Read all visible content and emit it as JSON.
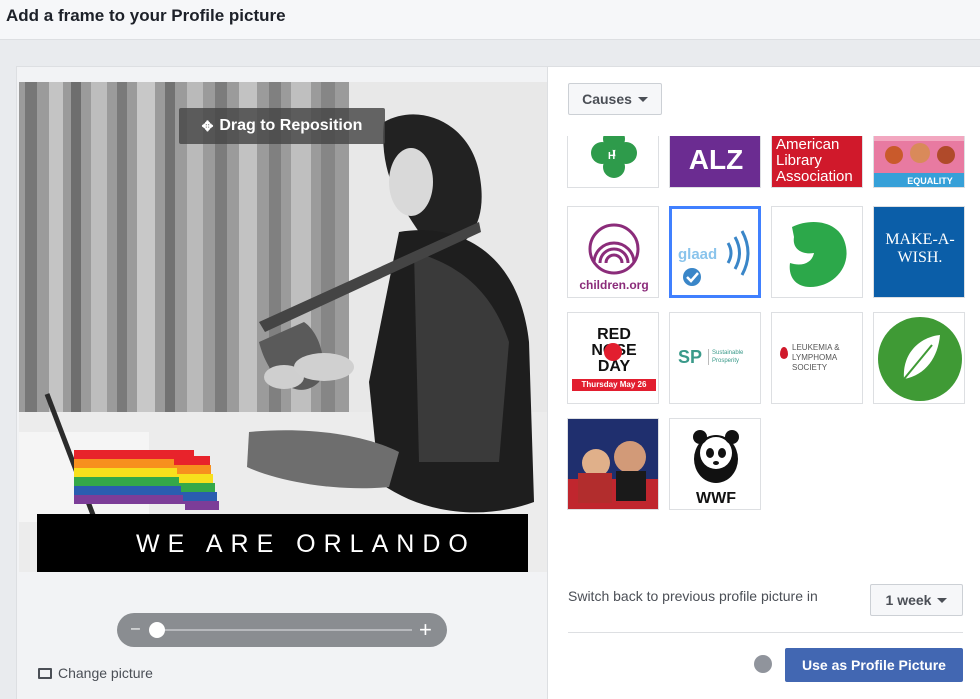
{
  "header": {
    "title": "Add a frame to your Profile picture"
  },
  "editor": {
    "drag_label": "Drag to Reposition",
    "frame_caption": "WE ARE ORLANDO",
    "zoom": {
      "minus": "–",
      "plus": "+",
      "level": 0.0
    },
    "change_picture": "Change picture"
  },
  "frames": {
    "category": "Causes",
    "tiles": [
      {
        "id": "4h",
        "label": ""
      },
      {
        "id": "alz",
        "label": "ALZ"
      },
      {
        "id": "ala",
        "label": "American Library Association"
      },
      {
        "id": "equality",
        "label": "EQUALITY"
      },
      {
        "id": "children",
        "label": "children.org"
      },
      {
        "id": "glaad",
        "label": "glaad",
        "selected": true
      },
      {
        "id": "girlscouts",
        "label": ""
      },
      {
        "id": "makeawish",
        "label_line1": "MAKE-A-",
        "label_line2": "WISH."
      },
      {
        "id": "rednoseday",
        "label_line1": "RED",
        "label_line2": "NOSE",
        "label_line3": "DAY",
        "label_line4": "Thursday May 26"
      },
      {
        "id": "sp",
        "label": "SP",
        "sub_line1": "Sustainable",
        "sub_line2": "Prosperity"
      },
      {
        "id": "lls",
        "label_line1": "LEUKEMIA &",
        "label_line2": "LYMPHOMA",
        "label_line3": "SOCIETY"
      },
      {
        "id": "leaf",
        "label": ""
      },
      {
        "id": "military",
        "label": ""
      },
      {
        "id": "wwf",
        "label": "WWF"
      }
    ]
  },
  "footer": {
    "switch_back_label": "Switch back to previous profile picture in",
    "duration": "1 week",
    "use_button": "Use as Profile Picture"
  },
  "colors": {
    "primary": "#4267b2",
    "selected_border": "#4080ff",
    "alz_purple": "#6b2c91",
    "ala_red": "#d0192b",
    "girlscouts_green": "#2ca84a",
    "makeawish_blue": "#0b5ea8",
    "leaf_green": "#3f9a35"
  }
}
